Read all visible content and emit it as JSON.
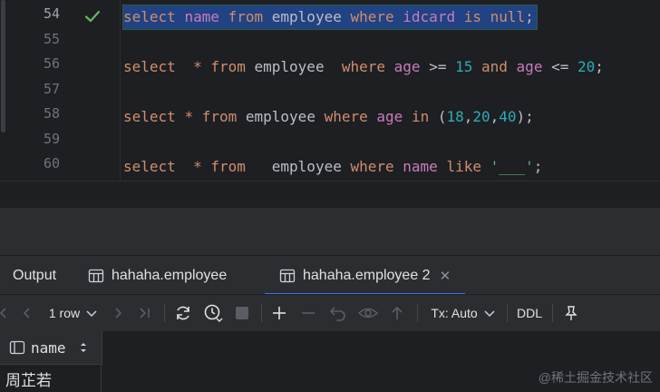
{
  "editor": {
    "line_numbers": [
      "54",
      "55",
      "56",
      "57",
      "58",
      "59",
      "60"
    ],
    "current_line": "54",
    "lines": [
      [
        {
          "t": "select",
          "c": "kw"
        },
        {
          "t": " ",
          "c": "id"
        },
        {
          "t": "name",
          "c": "field"
        },
        {
          "t": " ",
          "c": "id"
        },
        {
          "t": "from",
          "c": "kw"
        },
        {
          "t": " employee ",
          "c": "id"
        },
        {
          "t": "where",
          "c": "kw"
        },
        {
          "t": " ",
          "c": "id"
        },
        {
          "t": "idcard",
          "c": "field"
        },
        {
          "t": " ",
          "c": "id"
        },
        {
          "t": "is",
          "c": "kw"
        },
        {
          "t": " ",
          "c": "id"
        },
        {
          "t": "null",
          "c": "kw"
        },
        {
          "t": ";",
          "c": "op"
        }
      ],
      [],
      [
        {
          "t": "select",
          "c": "kw"
        },
        {
          "t": "  ",
          "c": "id"
        },
        {
          "t": "*",
          "c": "kw"
        },
        {
          "t": " ",
          "c": "id"
        },
        {
          "t": "from",
          "c": "kw"
        },
        {
          "t": " employee  ",
          "c": "id"
        },
        {
          "t": "where",
          "c": "kw"
        },
        {
          "t": " ",
          "c": "id"
        },
        {
          "t": "age",
          "c": "field"
        },
        {
          "t": " >= ",
          "c": "op"
        },
        {
          "t": "15",
          "c": "num"
        },
        {
          "t": " ",
          "c": "id"
        },
        {
          "t": "and",
          "c": "kw"
        },
        {
          "t": " ",
          "c": "id"
        },
        {
          "t": "age",
          "c": "field"
        },
        {
          "t": " <= ",
          "c": "op"
        },
        {
          "t": "20",
          "c": "num"
        },
        {
          "t": ";",
          "c": "op"
        }
      ],
      [],
      [
        {
          "t": "select",
          "c": "kw"
        },
        {
          "t": " ",
          "c": "id"
        },
        {
          "t": "*",
          "c": "kw"
        },
        {
          "t": " ",
          "c": "id"
        },
        {
          "t": "from",
          "c": "kw"
        },
        {
          "t": " employee ",
          "c": "id"
        },
        {
          "t": "where",
          "c": "kw"
        },
        {
          "t": " ",
          "c": "id"
        },
        {
          "t": "age",
          "c": "field"
        },
        {
          "t": " ",
          "c": "id"
        },
        {
          "t": "in",
          "c": "kw"
        },
        {
          "t": " (",
          "c": "op"
        },
        {
          "t": "18",
          "c": "num"
        },
        {
          "t": ",",
          "c": "op"
        },
        {
          "t": "20",
          "c": "num"
        },
        {
          "t": ",",
          "c": "op"
        },
        {
          "t": "40",
          "c": "num"
        },
        {
          "t": ");",
          "c": "op"
        }
      ],
      [],
      [
        {
          "t": "select",
          "c": "kw"
        },
        {
          "t": "  ",
          "c": "id"
        },
        {
          "t": "*",
          "c": "kw"
        },
        {
          "t": " ",
          "c": "id"
        },
        {
          "t": "from",
          "c": "kw"
        },
        {
          "t": "   employee ",
          "c": "id"
        },
        {
          "t": "where",
          "c": "kw"
        },
        {
          "t": " ",
          "c": "id"
        },
        {
          "t": "name",
          "c": "field"
        },
        {
          "t": " ",
          "c": "id"
        },
        {
          "t": "like",
          "c": "kw"
        },
        {
          "t": " ",
          "c": "id"
        },
        {
          "t": "'___'",
          "c": "str"
        },
        {
          "t": ";",
          "c": "op"
        }
      ]
    ]
  },
  "tabs": [
    {
      "label": "Output",
      "icon": "output-icon"
    },
    {
      "label": "hahaha.employee",
      "icon": "table-icon"
    },
    {
      "label": "hahaha.employee 2",
      "icon": "table-icon",
      "active": true
    }
  ],
  "toolbar": {
    "rows_label": "1 row",
    "tx_label": "Tx: Auto",
    "ddl_label": "DDL"
  },
  "grid": {
    "columns": [
      "name"
    ],
    "rows": [
      [
        "周芷若"
      ]
    ]
  },
  "watermark": "@稀土掘金技术社区",
  "colors": {
    "accent": "#3574f0",
    "selection": "#214283",
    "check": "#5fb865"
  }
}
